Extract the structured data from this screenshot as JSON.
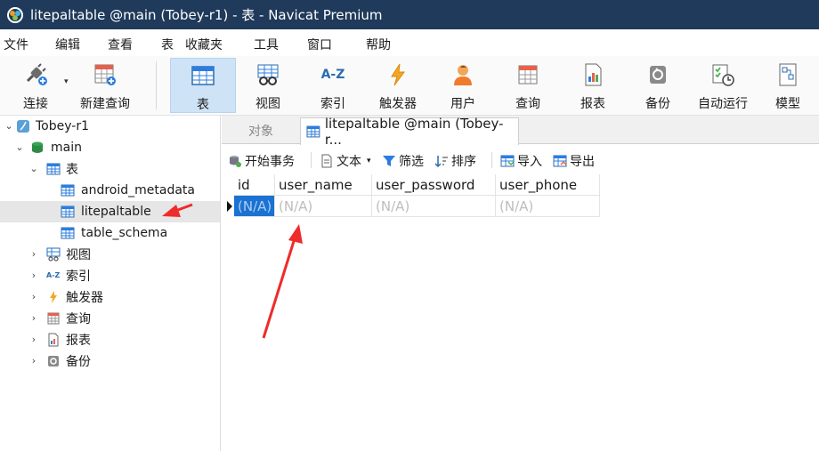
{
  "window": {
    "title": "litepaltable @main (Tobey-r1) - 表 - Navicat Premium"
  },
  "menu": [
    "文件",
    "编辑",
    "查看",
    "表",
    "收藏夹",
    "工具",
    "窗口",
    "帮助"
  ],
  "toolbar": {
    "connect": "连接",
    "new_query": "新建查询",
    "table": "表",
    "view": "视图",
    "index": "索引",
    "trigger": "触发器",
    "user": "用户",
    "query": "查询",
    "report": "报表",
    "backup": "备份",
    "automation": "自动运行",
    "model": "模型",
    "index_icon_text": "A-Z"
  },
  "tree": {
    "connection": "Tobey-r1",
    "database": "main",
    "tables_group": "表",
    "tables": [
      "android_metadata",
      "litepaltable",
      "table_schema"
    ],
    "selected_table": "litepaltable",
    "views": "视图",
    "indexes": "索引",
    "triggers": "触发器",
    "queries": "查询",
    "reports": "报表",
    "backups": "备份",
    "index_icon_text": "A-Z"
  },
  "tabs": {
    "objects": "对象",
    "active": "litepaltable @main (Tobey-r..."
  },
  "subtoolbar": {
    "begin_transaction": "开始事务",
    "text": "文本",
    "filter": "筛选",
    "sort": "排序",
    "import": "导入",
    "export": "导出"
  },
  "grid": {
    "columns": [
      "id",
      "user_name",
      "user_password",
      "user_phone"
    ],
    "rows": [
      [
        "(N/A)",
        "(N/A)",
        "(N/A)",
        "(N/A)"
      ]
    ]
  },
  "colors": {
    "titlebar": "#1f3a5a",
    "selected_cell": "#1a72d3",
    "annotation_arrow": "#ef2b2b",
    "toolbar_active": "#cfe3f7"
  }
}
